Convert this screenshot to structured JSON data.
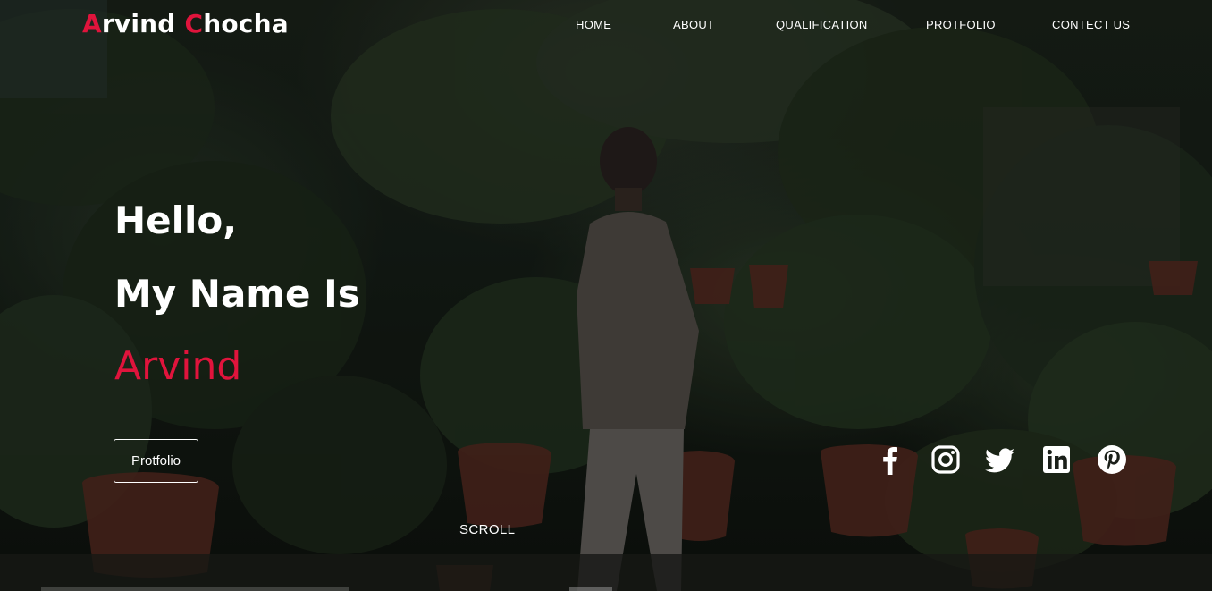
{
  "logo": {
    "first_initial": "A",
    "first_rest": "rvind ",
    "last_initial": "C",
    "last_rest": "hocha",
    "accent_color": "#e0143c"
  },
  "nav": {
    "items": [
      {
        "label": "HOME"
      },
      {
        "label": "ABOUT"
      },
      {
        "label": "QUALIFICATION"
      },
      {
        "label": "PROTFOLIO"
      },
      {
        "label": "CONTECT US"
      }
    ]
  },
  "hero": {
    "line1": "Hello,",
    "line2": "My Name Is",
    "name": "Arvind",
    "button_label": "Protfolio",
    "scroll_label": "SCROLL"
  },
  "social": [
    {
      "icon": "facebook-icon"
    },
    {
      "icon": "instagram-icon"
    },
    {
      "icon": "twitter-icon"
    },
    {
      "icon": "linkedin-icon"
    },
    {
      "icon": "pinterest-icon"
    }
  ],
  "colors": {
    "accent": "#e0143c",
    "text": "#ffffff"
  }
}
